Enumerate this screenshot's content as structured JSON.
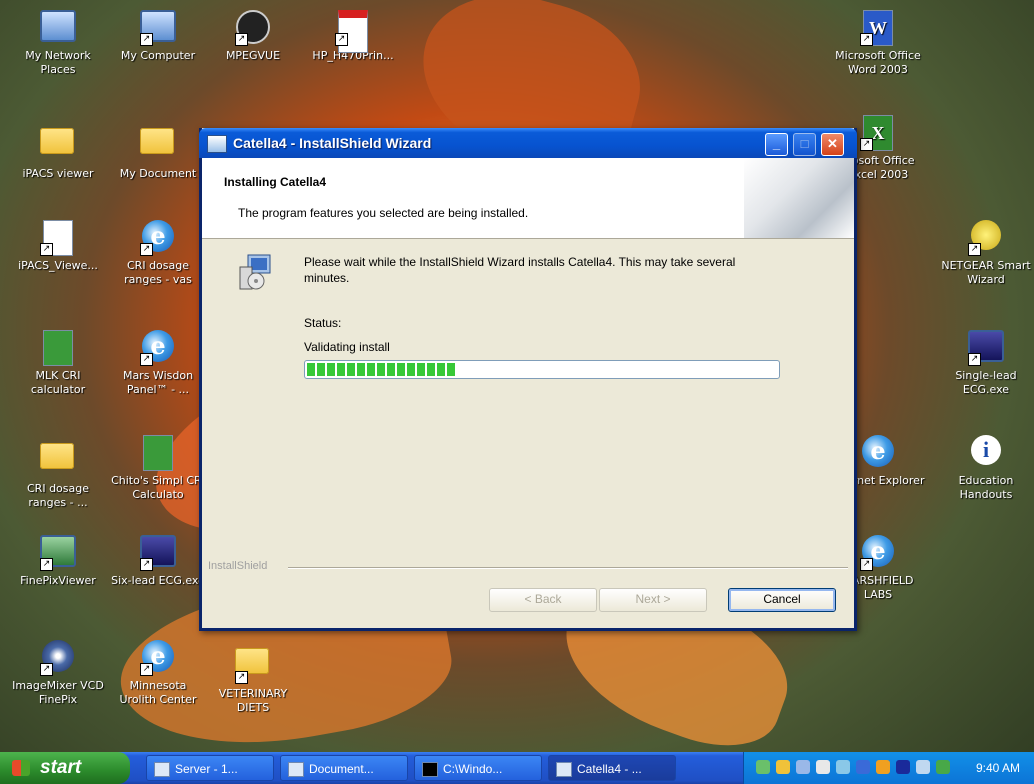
{
  "desktop": {
    "icons": [
      {
        "label": "My Network Places"
      },
      {
        "label": "My Computer"
      },
      {
        "label": "MPEGVUE"
      },
      {
        "label": "HP_H470Prin..."
      },
      {
        "label": "iPACS viewer"
      },
      {
        "label": "My Document"
      },
      {
        "label": "iPACS_Viewe..."
      },
      {
        "label": "CRI dosage ranges - vas"
      },
      {
        "label": "MLK CRI calculator"
      },
      {
        "label": "Mars Wisdon Panel™ - ..."
      },
      {
        "label": "CRI dosage ranges - ..."
      },
      {
        "label": "Chito's Simpl CRI Calculato"
      },
      {
        "label": "FinePixViewer"
      },
      {
        "label": "Six-lead ECG.exe"
      },
      {
        "label": "ImageMixer VCD FinePix"
      },
      {
        "label": "Minnesota Urolith Center"
      },
      {
        "label": "VETERINARY DIETS"
      },
      {
        "label": "Microsoft Office Word 2003"
      },
      {
        "label": "crosoft Office Excel 2003"
      },
      {
        "label": "NETGEAR Smart Wizard"
      },
      {
        "label": "Single-lead ECG.exe"
      },
      {
        "label": "Internet Explorer"
      },
      {
        "label": "Education Handouts"
      },
      {
        "label": "MARSHFIELD LABS"
      }
    ]
  },
  "window": {
    "title": "Catella4 - InstallShield Wizard",
    "header_title": "Installing Catella4",
    "header_subtitle": "The program features you selected are being installed.",
    "message": "Please wait while the InstallShield Wizard installs Catella4. This may take several minutes.",
    "status_label": "Status:",
    "status_value": "Validating install",
    "progress_fraction": 0.32,
    "brand": "InstallShield",
    "buttons": {
      "back": "< Back",
      "next": "Next >",
      "cancel": "Cancel"
    },
    "title_buttons": {
      "minimize": "_",
      "maximize": "□",
      "close": "✕"
    }
  },
  "taskbar": {
    "start_label": "start",
    "items": [
      {
        "label": "Server - 1..."
      },
      {
        "label": "Document..."
      },
      {
        "label": "C:\\Windo..."
      },
      {
        "label": "Catella4 - ..."
      }
    ],
    "clock": "9:40 AM"
  }
}
